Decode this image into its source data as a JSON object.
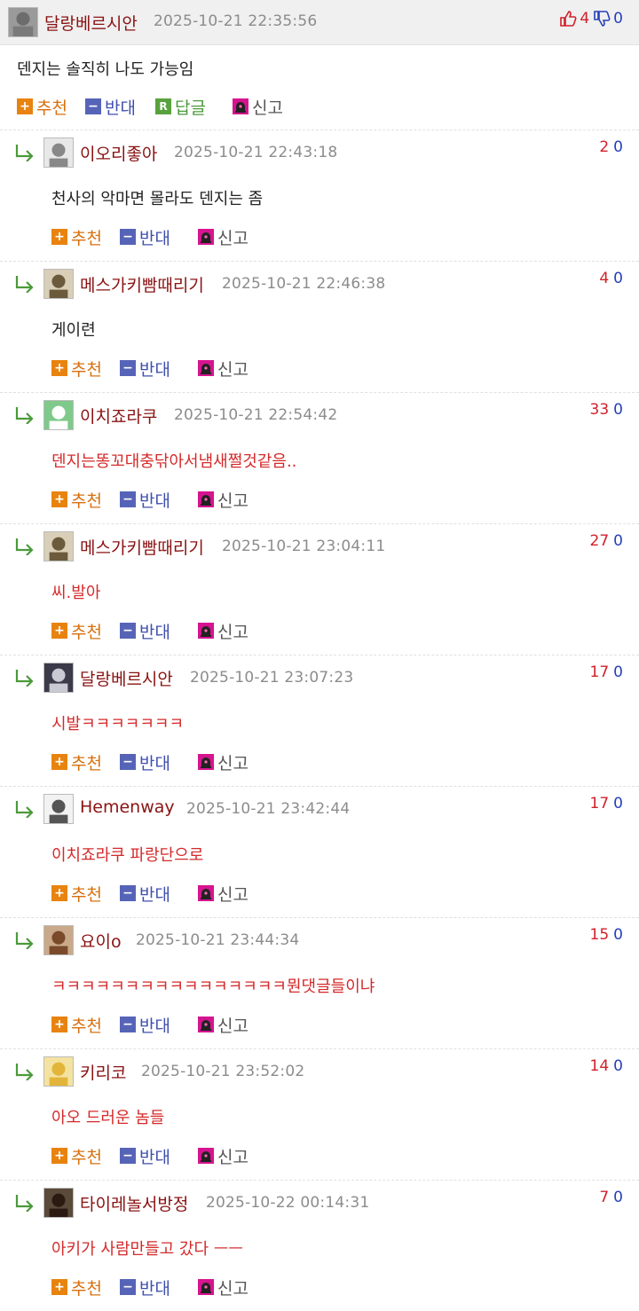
{
  "parent": {
    "nickname": "달랑베르시안",
    "date": "2025-10-21 22:35:56",
    "up": "4",
    "down": "0",
    "text": "덴지는 솔직히 나도 가능임"
  },
  "actions": {
    "recommend": "추천",
    "oppose": "반대",
    "reply": "답글",
    "report": "신고",
    "reply_icon": "R"
  },
  "replies": [
    {
      "nickname": "이오리좋아",
      "date": "2025-10-21 22:43:18",
      "up": "2",
      "down": "0",
      "text": "천사의 악마면 몰라도 덴지는 좀",
      "text_color": "black"
    },
    {
      "nickname": "메스가키빰때리기",
      "date": "2025-10-21 22:46:38",
      "up": "4",
      "down": "0",
      "text": "게이련",
      "text_color": "black"
    },
    {
      "nickname": "이치죠라쿠",
      "date": "2025-10-21 22:54:42",
      "up": "33",
      "down": "0",
      "text": "덴지는똥꼬대충닦아서냄새쩔것같음..",
      "text_color": "red"
    },
    {
      "nickname": "메스가키빰때리기",
      "date": "2025-10-21 23:04:11",
      "up": "27",
      "down": "0",
      "text": "씨.발아",
      "text_color": "red"
    },
    {
      "nickname": "달랑베르시안",
      "date": "2025-10-21 23:07:23",
      "up": "17",
      "down": "0",
      "text": "시발ㅋㅋㅋㅋㅋㅋㅋ",
      "text_color": "red"
    },
    {
      "nickname": "Hemenway",
      "date": "2025-10-21 23:42:44",
      "up": "17",
      "down": "0",
      "text": "이치죠라쿠 파랑단으로",
      "text_color": "red"
    },
    {
      "nickname": "요이o",
      "date": "2025-10-21 23:44:34",
      "up": "15",
      "down": "0",
      "text": "ㅋㅋㅋㅋㅋㅋㅋㅋㅋㅋㅋㅋㅋㅋㅋㅋ뭔댓글들이냐",
      "text_color": "red"
    },
    {
      "nickname": "키리코",
      "date": "2025-10-21 23:52:02",
      "up": "14",
      "down": "0",
      "text": "아오 드러운 놈들",
      "text_color": "red"
    },
    {
      "nickname": "타이레놀서방정",
      "date": "2025-10-22 00:14:31",
      "up": "7",
      "down": "0",
      "text": "아키가 사람만들고 갔다 ㅡㅡ",
      "text_color": "red"
    }
  ],
  "colors": {
    "nickname": "#8a1212",
    "up": "#d0202a",
    "down": "#2740b8",
    "red_text": "#d42a2a",
    "recommend": "#d8700e",
    "oppose": "#3f4fad",
    "reply": "#4b9a3a"
  },
  "icons": [
    "thumbs-up-icon",
    "thumbs-down-icon",
    "reply-arrow-icon",
    "plus-icon",
    "minus-icon",
    "reply-badge-icon",
    "siren-report-icon"
  ]
}
